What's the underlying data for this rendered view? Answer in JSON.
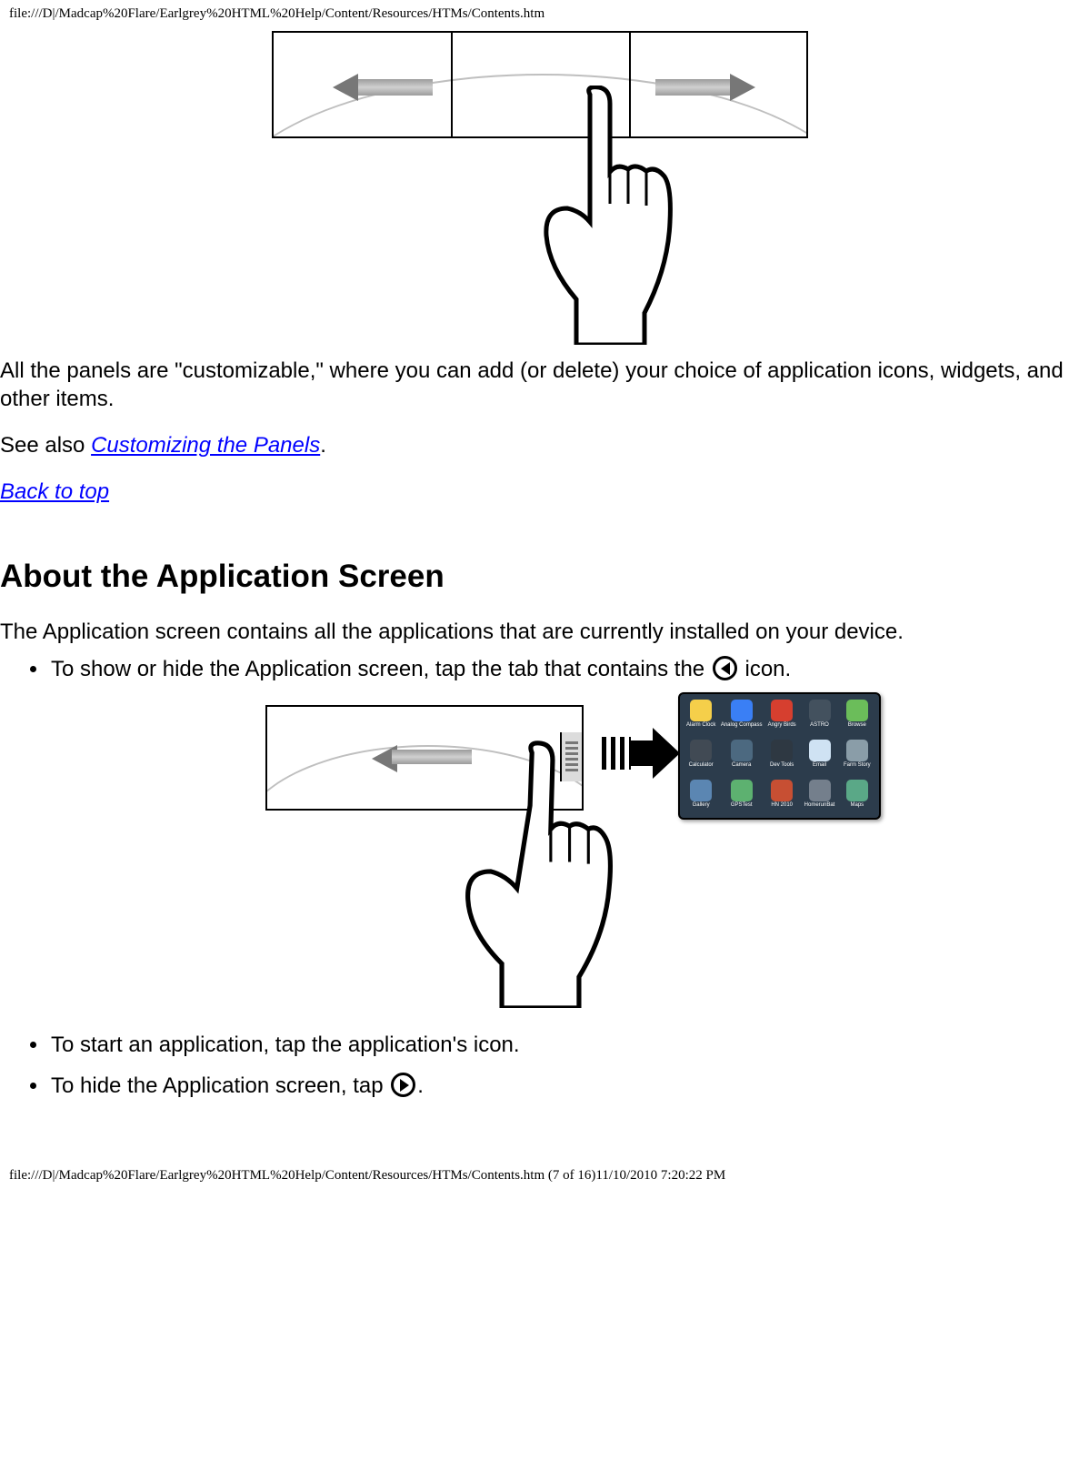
{
  "header_path": "file:///D|/Madcap%20Flare/Earlgrey%20HTML%20Help/Content/Resources/HTMs/Contents.htm",
  "para1": "All the panels are \"customizable,\" where you can add (or delete) your choice of application icons, widgets, and other items.",
  "see_also_prefix": "See also ",
  "see_also_link": "Customizing the Panels",
  "see_also_suffix": ".",
  "back_to_top": "Back to top",
  "section_heading": "About the Application Screen",
  "para2": "The Application screen contains all the applications that are currently installed on your device.",
  "bullet1_a": "To show or hide the Application screen, tap the tab that contains the ",
  "bullet1_b": " icon.",
  "bullet2": "To start an application, tap the application's icon.",
  "bullet3_a": "To hide the Application screen, tap ",
  "bullet3_b": ".",
  "app_labels": [
    "Alarm Clock",
    "Analog Compass",
    "Angry Birds",
    "ASTRO",
    "Browse",
    "Calculator",
    "Camera",
    "Dev Tools",
    "Email",
    "Farm Story",
    "Gallery",
    "GPSTest",
    "HN 2010",
    "HomerunBat",
    "Maps"
  ],
  "footer_path": "file:///D|/Madcap%20Flare/Earlgrey%20HTML%20Help/Content/Resources/HTMs/Contents.htm (7 of 16)11/10/2010 7:20:22 PM"
}
